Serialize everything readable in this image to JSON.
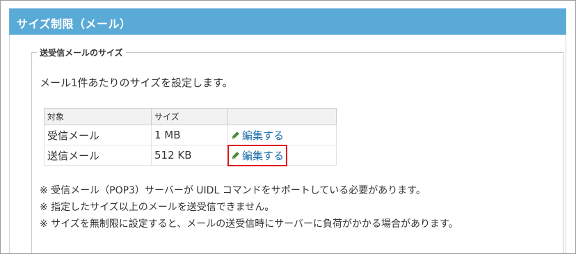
{
  "panel": {
    "title": "サイズ制限（メール）"
  },
  "section": {
    "legend": "送受信メールのサイズ",
    "description": "メール1件あたりのサイズを設定します。"
  },
  "table": {
    "headers": [
      "対象",
      "サイズ",
      ""
    ],
    "rows": [
      {
        "target": "受信メール",
        "size": "1 MB",
        "action": "編集する"
      },
      {
        "target": "送信メール",
        "size": "512 KB",
        "action": "編集する"
      }
    ]
  },
  "notes": [
    "※ 受信メール（POP3）サーバーが UIDL コマンドをサポートしている必要があります。",
    "※ 指定したサイズ以上のメールを送受信できません。",
    "※ サイズを無制限に設定すると、メールの送受信時にサーバーに負荷がかかる場合があります。"
  ],
  "icons": {
    "edit": "pencil-icon"
  },
  "colors": {
    "header_bg": "#5aaad7",
    "link": "#1a6ea8",
    "highlight": "#e0141e",
    "pencil": "#3f9a2e"
  }
}
